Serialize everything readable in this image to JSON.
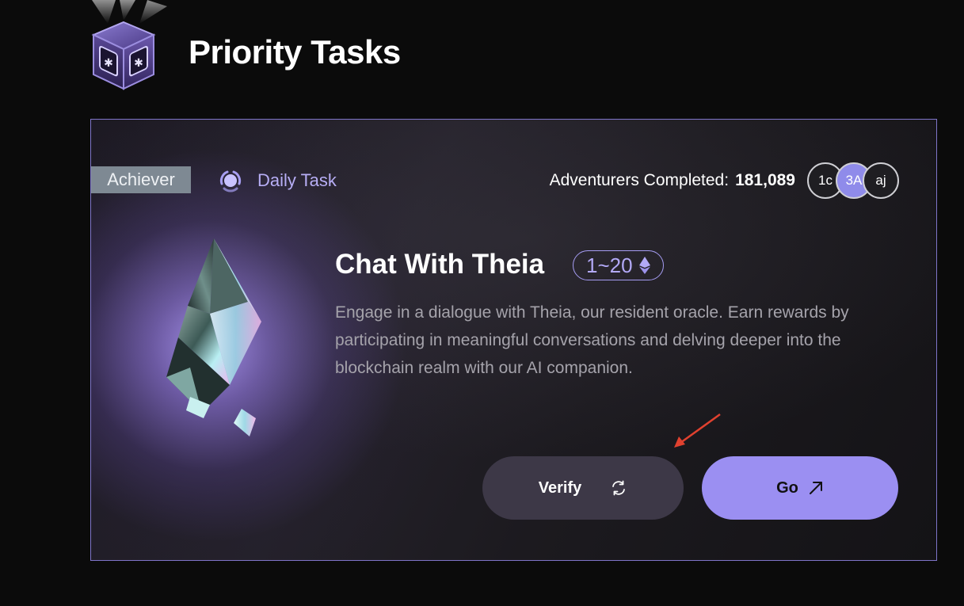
{
  "header": {
    "title": "Priority Tasks",
    "icon": "cube-emblem-icon"
  },
  "card": {
    "badge": "Achiever",
    "category_icon": "spinner-ring-icon",
    "category": "Daily Task",
    "adventurers_label": "Adventurers Completed:",
    "adventurers_count": "181,089",
    "avatars": [
      "1c",
      "3A",
      "aj"
    ],
    "title": "Chat With Theia",
    "reward_range": "1~20",
    "reward_icon": "eth-icon",
    "description": "Engage in a dialogue with Theia, our resident oracle. Earn rewards by participating in meaningful conversations and delving deeper into the blockchain realm with our AI companion.",
    "verify_label": "Verify",
    "verify_icon": "refresh-icon",
    "go_label": "Go",
    "go_icon": "arrow-up-right-icon"
  },
  "colors": {
    "accent": "#9b8ff2",
    "card_border": "#7f75c9",
    "badge_bg": "#7e8993",
    "verify_bg": "#3d3847",
    "annotation_arrow": "#e0412f"
  }
}
